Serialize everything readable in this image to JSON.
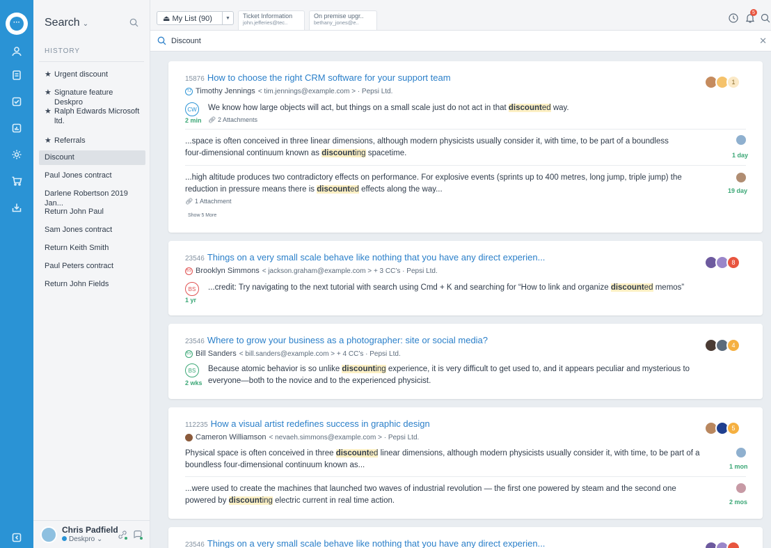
{
  "nav": {
    "title": "Search",
    "history_label": "HISTORY",
    "starred": [
      "Urgent discount",
      "Signature feature Deskpro",
      "Ralph Edwards Microsoft ltd.",
      "Referrals"
    ],
    "items": [
      "Discount",
      "Paul Jones contract",
      "Darlene Robertson 2019 Jan...",
      "Return John Paul",
      "Sam Jones contract",
      "Return Keith Smith",
      "Paul Peters contract",
      "Return John Fields"
    ],
    "user_name": "Chris Padfield",
    "user_org": "Deskpro"
  },
  "topbar": {
    "my_list": "My List (90)",
    "tabs": [
      {
        "title": "Ticket Information",
        "sub": "john.jefferies@tec.."
      },
      {
        "title": "On premise upgr..",
        "sub": "bethany_jones@e.."
      }
    ],
    "notif_count": "5"
  },
  "search": {
    "value": "Discount"
  },
  "results": [
    {
      "id": "15876",
      "title": "How to choose the right CRM software for your support team",
      "initials": "TJ",
      "name": "Timothy Jennings",
      "email": "< tim.jennings@example.com >",
      "cc": "",
      "org": "· Pepsi Ltd.",
      "count": "1",
      "snippet_circle": "CW",
      "age": "2 min",
      "attachments": "2 Attachments",
      "s1": [
        "We know how large objects will act, but things on a small scale just do not act in that ",
        "discount",
        "ed",
        " way."
      ],
      "s2a": [
        "...space is often conceived in three linear dimensions, although modern physicists usually consider it, with time, to be part of a boundless"
      ],
      "s2b": [
        "four-dimensional continuum known as ",
        "discount",
        "ing",
        " spacetime."
      ],
      "age2": "1 day",
      "s3a": [
        "...high altitude produces two contradictory effects on performance. For explosive events (sprints up to 400 metres, long jump, triple jump) the"
      ],
      "s3b": [
        "reduction in pressure means there is ",
        "discount",
        "ed",
        " effects along the way..."
      ],
      "age3": "19 day",
      "att3": "1 Attachment",
      "more": "Show 5 More"
    },
    {
      "id": "23546",
      "title": "Things on a very small scale behave like nothing that you have any direct experien...",
      "initials": "BS",
      "name": "Brooklyn Simmons",
      "email": "< jackson.graham@example.com >",
      "cc": "+ 3 CC’s",
      "org": "· Pepsi Ltd.",
      "count": "8",
      "snippet_circle": "BS",
      "age": "1 yr",
      "s1": [
        "...credit: Try navigating to the next tutorial with search using Cmd + K and searching for “How to link and organize ",
        "discount",
        "ed",
        " memos”"
      ]
    },
    {
      "id": "23546",
      "title": "Where to grow your business as a photographer: site or social media?",
      "initials": "BS",
      "name": "Bill Sanders",
      "email": "< bill.sanders@example.com >",
      "cc": "+ 4 CC’s",
      "org": "· Pepsi Ltd.",
      "count": "4",
      "snippet_circle": "BS",
      "age": "2 wks",
      "s1": [
        "Because atomic behavior is so unlike ",
        "discount",
        "ing",
        " experience, it is very difficult to get used to, and it appears peculiar and mysterious to"
      ],
      "s1b": "everyone—both to the novice and to the experienced physicist."
    },
    {
      "id": "112235",
      "title": "How a visual artist redefines success in graphic design",
      "name": "Cameron Williamson",
      "email": "< nevaeh.simmons@example.com >",
      "cc": "",
      "org": "· Pepsi Ltd.",
      "count": "5",
      "s1": [
        "Physical space is often conceived in three ",
        "discount",
        "ed",
        " linear dimensions, although modern physicists usually consider it, with time, to be part of a"
      ],
      "s1b": "boundless four-dimensional continuum known as...",
      "age": "1 mon",
      "s2a": [
        "...were used to create the machines that launched two waves of industrial revolution — the first one powered by steam and the second one"
      ],
      "s2b": [
        "powered by ",
        "discount",
        "ing",
        " electric current in real time action."
      ],
      "age2": "2 mos"
    },
    {
      "id": "23546",
      "title": "Things on a very small scale behave like nothing that you have any direct experien..."
    }
  ],
  "colors": {
    "rail": "#2a93d5",
    "link": "#2a7fc9",
    "highlight": "#fdf0c4",
    "age_green": "#3ba776",
    "count_orange": "#f5b041",
    "count_red": "#e8553f"
  }
}
